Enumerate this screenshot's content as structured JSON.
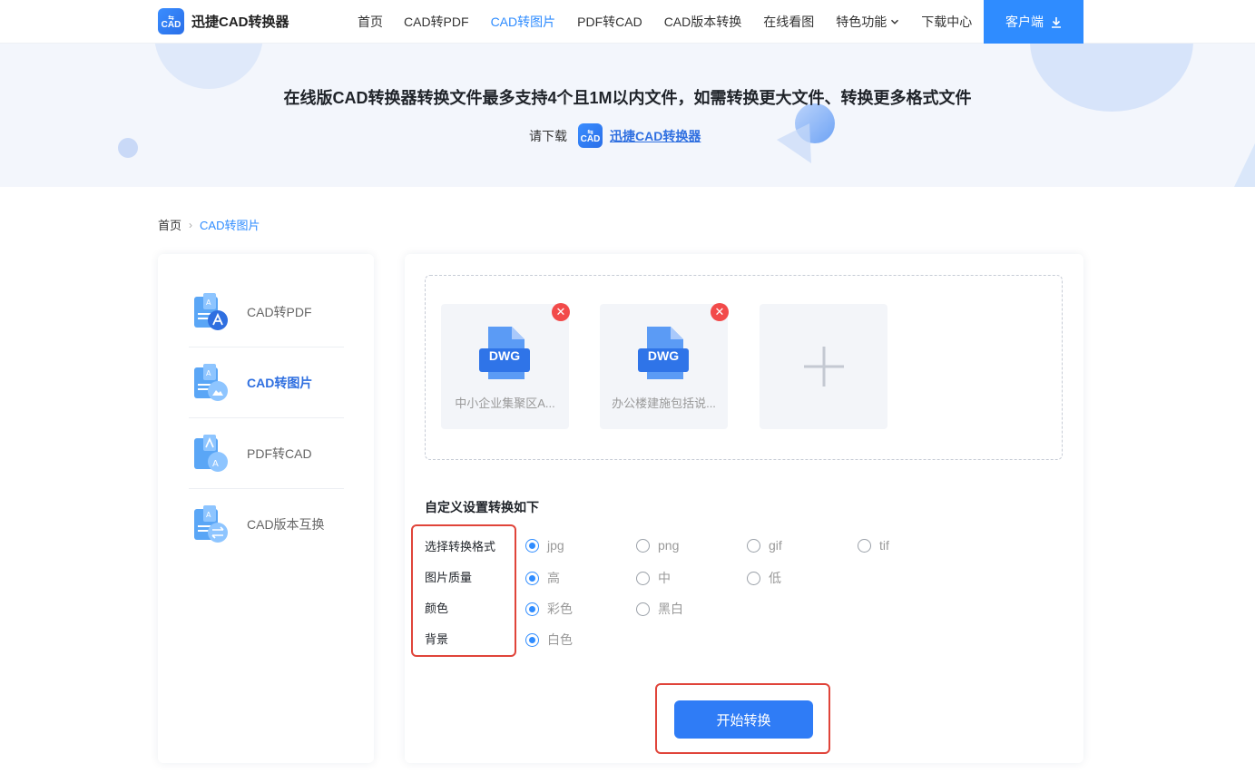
{
  "header": {
    "brand": "迅捷CAD转换器",
    "logo_text": "CAD",
    "nav": [
      {
        "label": "首页"
      },
      {
        "label": "CAD转PDF"
      },
      {
        "label": "CAD转图片",
        "active": true
      },
      {
        "label": "PDF转CAD"
      },
      {
        "label": "CAD版本转换"
      },
      {
        "label": "在线看图"
      },
      {
        "label": "特色功能"
      },
      {
        "label": "下载中心"
      }
    ],
    "client_button": "客户端"
  },
  "banner": {
    "title": "在线版CAD转换器转换文件最多支持4个且1M以内文件，如需转换更大文件、转换更多格式文件",
    "sub_prefix": "请下载",
    "link": "迅捷CAD转换器"
  },
  "breadcrumb": {
    "home": "首页",
    "current": "CAD转图片"
  },
  "sidebar": {
    "items": [
      {
        "label": "CAD转PDF"
      },
      {
        "label": "CAD转图片"
      },
      {
        "label": "PDF转CAD"
      },
      {
        "label": "CAD版本互换"
      }
    ]
  },
  "files": [
    {
      "badge": "DWG",
      "name": "中小企业集聚区A..."
    },
    {
      "badge": "DWG",
      "name": "办公楼建施包括说..."
    }
  ],
  "settings": {
    "title": "自定义设置转换如下",
    "rows": [
      {
        "label": "选择转换格式",
        "options": [
          "jpg",
          "png",
          "gif",
          "tif"
        ],
        "selected": "jpg"
      },
      {
        "label": "图片质量",
        "options": [
          "高",
          "中",
          "低"
        ],
        "selected": "高"
      },
      {
        "label": "颜色",
        "options": [
          "彩色",
          "黑白"
        ],
        "selected": "彩色"
      },
      {
        "label": "背景",
        "options": [
          "白色"
        ],
        "selected": "白色"
      }
    ]
  },
  "start_button": "开始转换",
  "colors": {
    "accent": "#2f8cff",
    "highlight": "#e0443a",
    "remove": "#f24a4a"
  }
}
